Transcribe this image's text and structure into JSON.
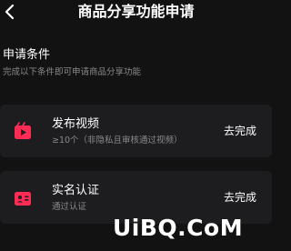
{
  "header": {
    "title": "商品分享功能申请",
    "back_icon": "chevron-left-icon"
  },
  "conditions": {
    "title": "申请条件",
    "subtitle": "完成以下条件即可申请商品分享功能",
    "items": [
      {
        "icon": "video-clapper-icon",
        "title": "发布视频",
        "detail": "≥10个（非隐私且审核通过视频）",
        "action": "去完成"
      },
      {
        "icon": "id-card-icon",
        "title": "实名认证",
        "detail": "通过认证",
        "action": "去完成"
      }
    ]
  },
  "colors": {
    "background": "#121212",
    "card": "#1d1d1f",
    "accent": "#fe2c55",
    "secondary_text": "#8a8a8a"
  },
  "watermark": "UiBQ.CoM"
}
